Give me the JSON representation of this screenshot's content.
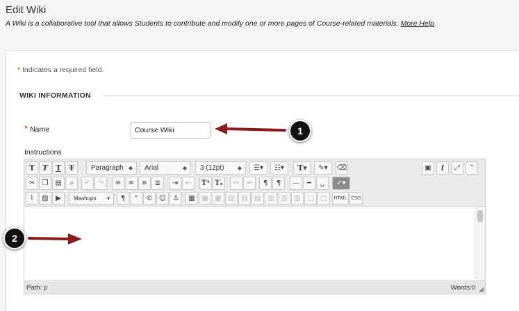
{
  "header": {
    "title": "Edit Wiki",
    "description": "A Wiki is a collaborative tool that allows Students to contribute and modify one or more pages of Course-related materials.",
    "help_link": "More Help"
  },
  "form": {
    "required_star": "*",
    "required_note": " Indicates a required field.",
    "section_title": "WIKI INFORMATION",
    "name_label": "Name",
    "name_value": "Course Wiki",
    "instructions_label": "Instructions"
  },
  "editor": {
    "paragraph_select": "Paragraph",
    "font_select": "Arial",
    "size_select": "3 (12pt)",
    "mashups_label": "Mashups",
    "html_label": "HTML",
    "css_label": "CSS",
    "path_text": "Path: p",
    "words_text": "Words:0"
  },
  "callouts": {
    "one": "1",
    "two": "2"
  },
  "colors": {
    "required_star": "#e8792f",
    "arrow": "#8b1a1a",
    "callout_bg": "#111111"
  }
}
